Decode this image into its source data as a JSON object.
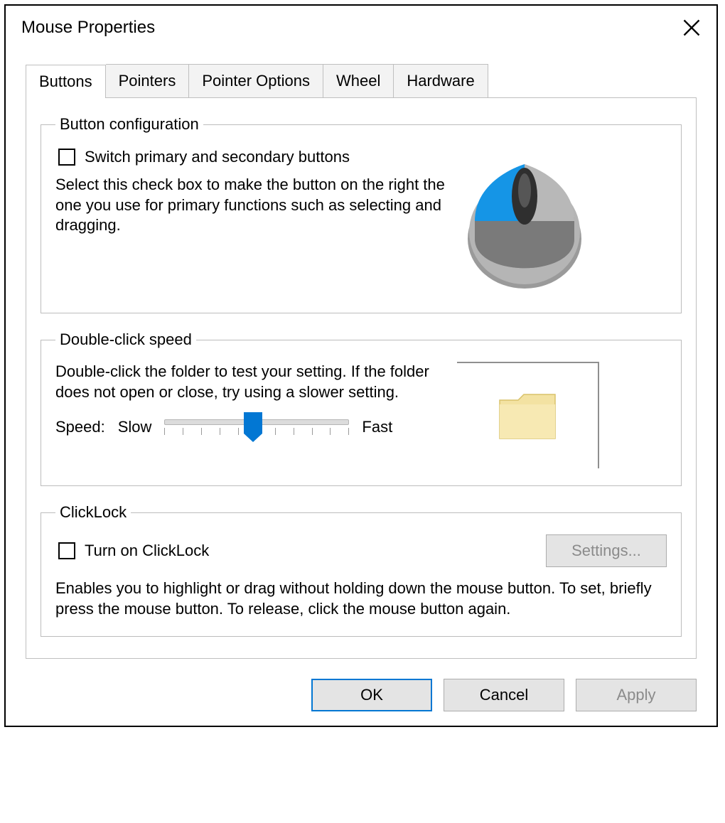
{
  "window": {
    "title": "Mouse Properties"
  },
  "tabs": [
    {
      "label": "Buttons",
      "active": true
    },
    {
      "label": "Pointers",
      "active": false
    },
    {
      "label": "Pointer Options",
      "active": false
    },
    {
      "label": "Wheel",
      "active": false
    },
    {
      "label": "Hardware",
      "active": false
    }
  ],
  "button_config": {
    "legend": "Button configuration",
    "checkbox_label": "Switch primary and secondary buttons",
    "checkbox_checked": false,
    "description": "Select this check box to make the button on the right the one you use for primary functions such as selecting and dragging."
  },
  "double_click": {
    "legend": "Double-click speed",
    "description": "Double-click the folder to test your setting. If the folder does not open or close, try using a slower setting.",
    "speed_label": "Speed:",
    "slow_label": "Slow",
    "fast_label": "Fast",
    "slider_position_percent": 48,
    "tick_count": 11
  },
  "clicklock": {
    "legend": "ClickLock",
    "checkbox_label": "Turn on ClickLock",
    "checkbox_checked": false,
    "settings_button": "Settings...",
    "settings_enabled": false,
    "description": "Enables you to highlight or drag without holding down the mouse button. To set, briefly press the mouse button. To release, click the mouse button again."
  },
  "dialog_buttons": {
    "ok": "OK",
    "cancel": "Cancel",
    "apply": "Apply",
    "apply_enabled": false
  }
}
